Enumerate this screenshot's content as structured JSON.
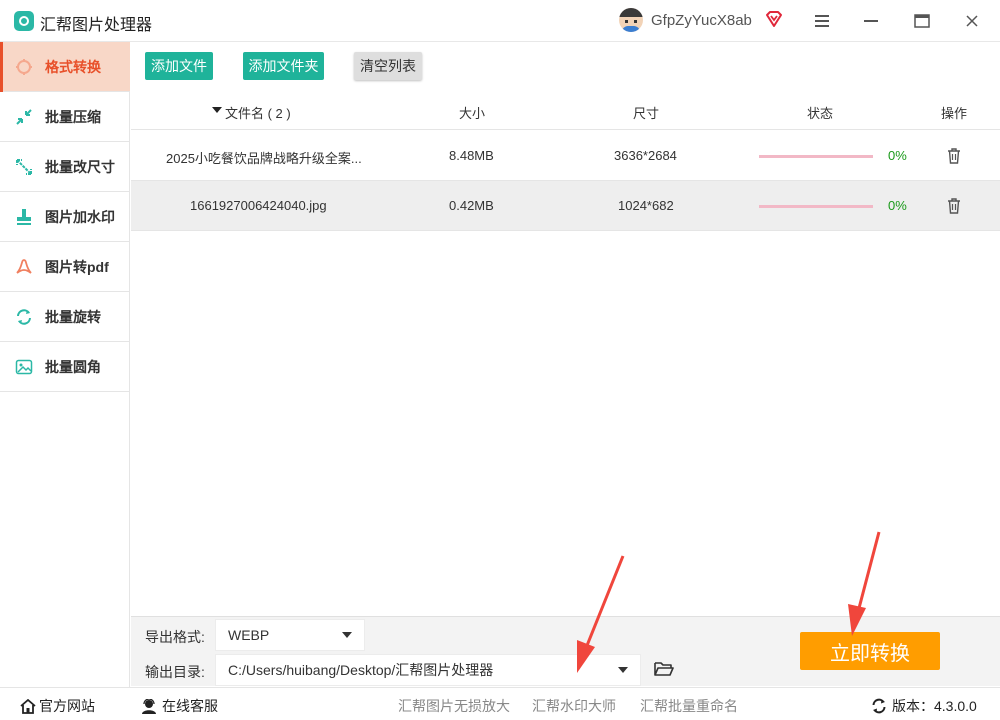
{
  "app": {
    "title": "汇帮图片处理器",
    "username": "GfpZyYucX8ab"
  },
  "sidebar": {
    "items": [
      {
        "label": "格式转换",
        "icon": "format-convert-icon",
        "active": true
      },
      {
        "label": "批量压缩",
        "icon": "compress-icon"
      },
      {
        "label": "批量改尺寸",
        "icon": "resize-icon"
      },
      {
        "label": "图片加水印",
        "icon": "watermark-icon"
      },
      {
        "label": "图片转pdf",
        "icon": "pdf-icon"
      },
      {
        "label": "批量旋转",
        "icon": "rotate-icon"
      },
      {
        "label": "批量圆角",
        "icon": "rounded-corner-icon"
      }
    ]
  },
  "toolbar": {
    "add_file": "添加文件",
    "add_folder": "添加文件夹",
    "clear_list": "清空列表"
  },
  "table": {
    "headers": {
      "filename": "文件名 ( 2 )",
      "size": "大小",
      "dimensions": "尺寸",
      "status": "状态",
      "actions": "操作"
    },
    "rows": [
      {
        "filename": "2025小吃餐饮品牌战略升级全案...",
        "size": "8.48MB",
        "dimensions": "3636*2684",
        "progress": 0,
        "percent": "0%"
      },
      {
        "filename": "1661927006424040.jpg",
        "size": "0.42MB",
        "dimensions": "1024*682",
        "progress": 0,
        "percent": "0%"
      }
    ]
  },
  "settings": {
    "format_label": "导出格式:",
    "format_value": "WEBP",
    "dir_label": "输出目录:",
    "dir_value": "C:/Users/huibang/Desktop/汇帮图片处理器",
    "convert_button": "立即转换"
  },
  "footer": {
    "website": "官方网站",
    "support": "在线客服",
    "link1": "汇帮图片无损放大",
    "link2": "汇帮水印大师",
    "link3": "汇帮批量重命名",
    "version": "版本：4.3.0.0"
  },
  "colors": {
    "accent_teal": "#1fb39a",
    "active_orange": "#e8502a",
    "convert_orange": "#ff9d00",
    "arrow_red": "#f0463c"
  }
}
